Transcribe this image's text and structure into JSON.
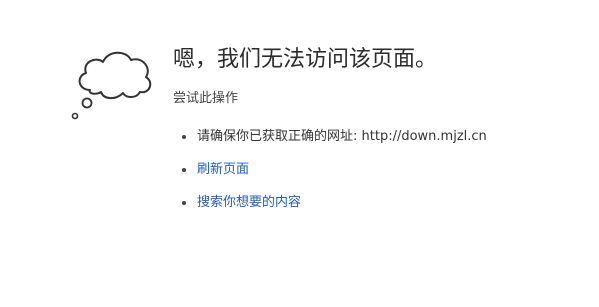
{
  "error": {
    "title": "嗯，我们无法访问该页面。",
    "subtitle": "尝试此操作"
  },
  "suggestions": [
    {
      "label": "请确保你已获取正确的网址: http://down.mjzl.cn",
      "link": false
    },
    {
      "label": "刷新页面",
      "link": true
    },
    {
      "label": "搜索你想要的内容",
      "link": true
    }
  ],
  "icon": "thinking-cloud-icon",
  "colors": {
    "link": "#1f5fbf",
    "text": "#333333"
  }
}
